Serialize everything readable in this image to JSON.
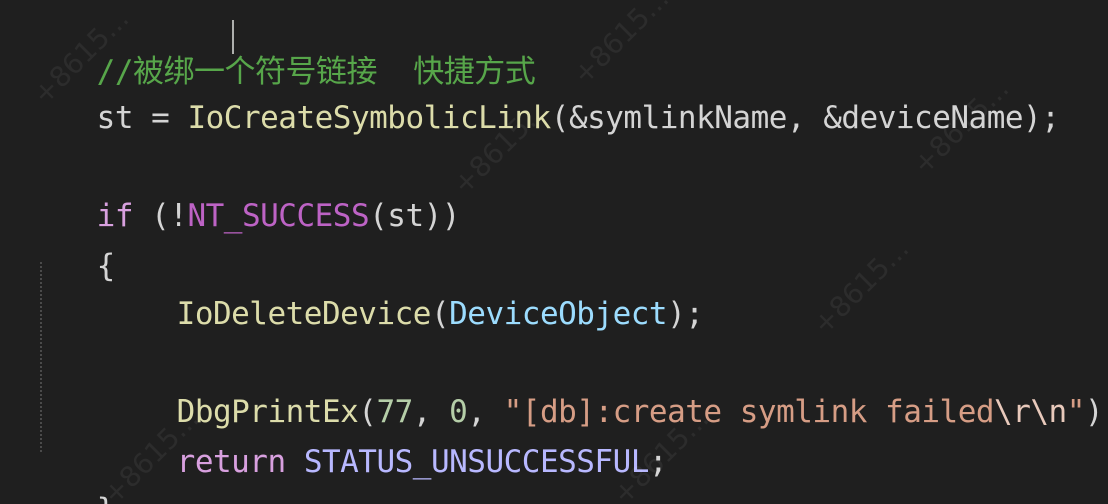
{
  "editor": {
    "line1_comment": "//被绑一个符号链接  快捷方式",
    "line2": {
      "var": "st",
      "op": " = ",
      "func": "IoCreateSymbolicLink",
      "open": "(",
      "arg1": "&symlinkName",
      "sep": ", ",
      "arg2": "&deviceName",
      "close": ");"
    },
    "line4": {
      "kw": "if",
      "open": " (!",
      "macro": "NT_SUCCESS",
      "p1": "(",
      "var": "st",
      "close": "))"
    },
    "line5_brace_open": "{",
    "line6": {
      "func": "IoDeleteDevice",
      "open": "(",
      "param": "DeviceObject",
      "close": ");"
    },
    "line8": {
      "func": "DbgPrintEx",
      "open": "(",
      "n1": "77",
      "sep1": ", ",
      "n2": "0",
      "sep2": ", ",
      "str_open": "\"[db]:create symlink failed",
      "esc1": "\\r",
      "esc2": "\\n",
      "str_close": "\"",
      "close": ");"
    },
    "line9": {
      "kw": "return",
      "const": "STATUS_UNSUCCESSFUL",
      "end": ";"
    },
    "line10_brace_close": "}"
  },
  "watermark": {
    "text": "+8615..."
  }
}
